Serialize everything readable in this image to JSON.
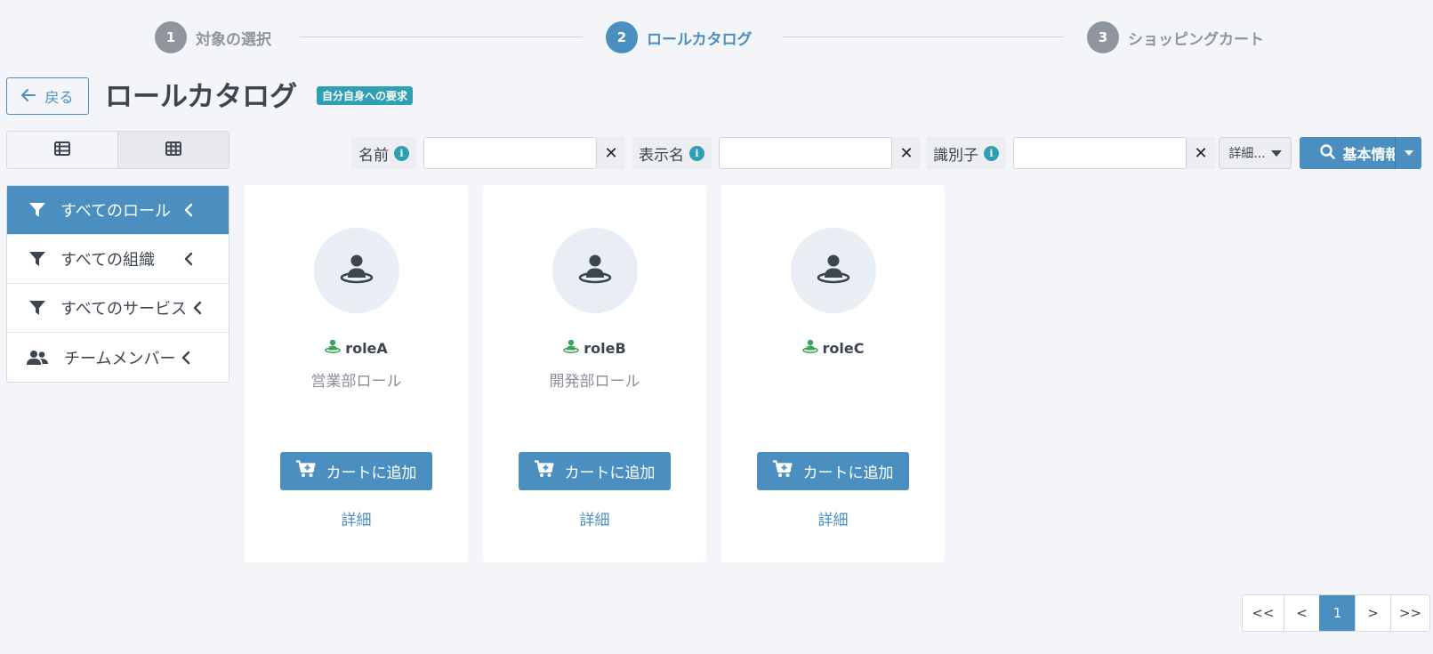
{
  "stepper": {
    "steps": [
      {
        "number": "1",
        "label": "対象の選択",
        "state": "done"
      },
      {
        "number": "2",
        "label": "ロールカタログ",
        "state": "active"
      },
      {
        "number": "3",
        "label": "ショッピングカート",
        "state": "pending"
      }
    ]
  },
  "header": {
    "back_label": "戻る",
    "title": "ロールカタログ",
    "badge": "自分自身への要求"
  },
  "view_toggle": {
    "options": [
      "list-icon",
      "grid-icon"
    ],
    "selected": "grid-icon"
  },
  "filters": {
    "fields": [
      {
        "label": "名前",
        "value": "",
        "placeholder": ""
      },
      {
        "label": "表示名",
        "value": "",
        "placeholder": ""
      },
      {
        "label": "識別子",
        "value": "",
        "placeholder": ""
      }
    ],
    "clear_symbol": "✕",
    "more_label": "詳細...",
    "search_label": "基本情報"
  },
  "sidebar": {
    "items": [
      {
        "label": "すべてのロール",
        "icon": "filter-icon",
        "active": true
      },
      {
        "label": "すべての組織",
        "icon": "filter-icon",
        "active": false
      },
      {
        "label": "すべてのサービス",
        "icon": "filter-icon",
        "active": false
      },
      {
        "label": "チームメンバー",
        "icon": "users-icon",
        "active": false
      }
    ]
  },
  "cards": [
    {
      "name": "roleA",
      "description": "営業部ロール",
      "add_label": "カートに追加",
      "detail_label": "詳細"
    },
    {
      "name": "roleB",
      "description": "開発部ロール",
      "add_label": "カートに追加",
      "detail_label": "詳細"
    },
    {
      "name": "roleC",
      "description": "",
      "add_label": "カートに追加",
      "detail_label": "詳細"
    }
  ],
  "pagination": {
    "first": "<<",
    "prev": "<",
    "current": "1",
    "next": ">",
    "last": ">>"
  },
  "colors": {
    "primary": "#4a8fc0",
    "badge": "#2fa0b3",
    "role_icon": "#3aa55a",
    "background": "#f4f5f8"
  }
}
